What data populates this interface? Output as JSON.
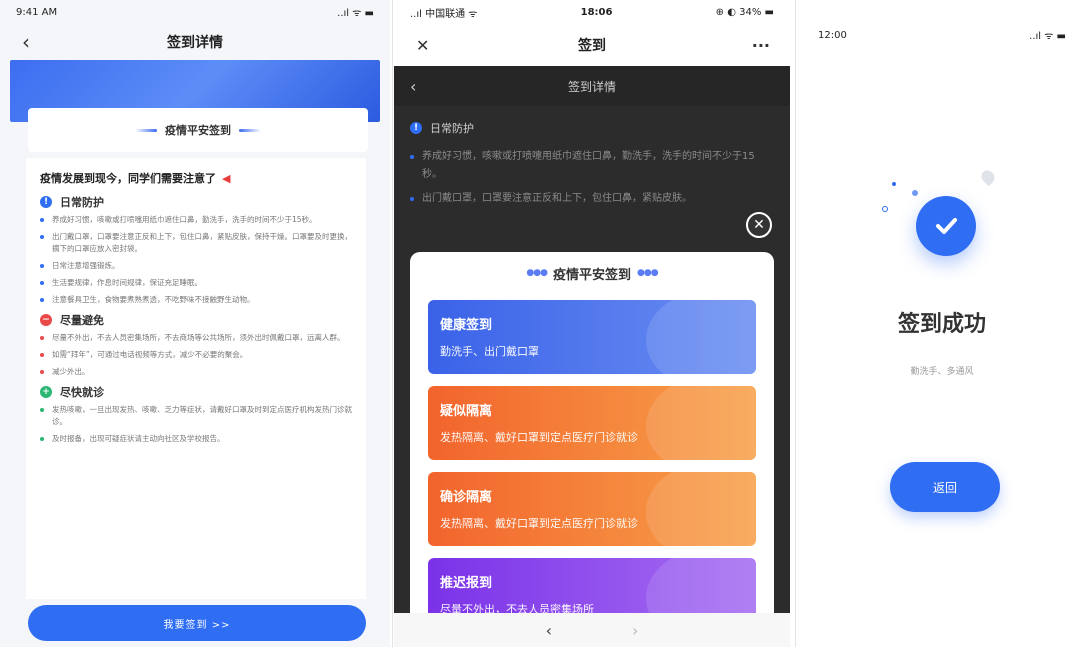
{
  "screen1": {
    "status": {
      "time": "9:41 AM",
      "signal": "..ıl ᯤ ▬"
    },
    "nav": {
      "back": "‹",
      "title": "签到详情"
    },
    "card_title": "疫情平安签到",
    "notice": "疫情发展到现今，同学们需要注意了",
    "sections": [
      {
        "icon": "info-icon",
        "icon_text": "!",
        "title": "日常防护",
        "color": "blue",
        "items": [
          "养成好习惯，咳嗽或打喷嚏用纸巾遮住口鼻，勤洗手，洗手的时间不少于15秒。",
          "出门戴口罩，口罩要注意正反和上下，包住口鼻，紧贴皮肤，保持干燥。口罩要及时更换，摘下的口罩应放入密封袋。",
          "日常注意增强锻炼。",
          "生活要规律，作息时间规律，保证充足睡眠。",
          "注意餐具卫生，食物要煮熟煮透，不吃野味不接触野生动物。"
        ]
      },
      {
        "icon": "minus-icon",
        "icon_text": "−",
        "title": "尽量避免",
        "color": "red",
        "items": [
          "尽量不外出，不去人员密集场所，不去商场等公共场所，须外出时佩戴口罩，远离人群。",
          "如需“拜年”，可通过电话视频等方式，减少不必要的聚会。",
          "减少外出。"
        ]
      },
      {
        "icon": "plus-icon",
        "icon_text": "+",
        "title": "尽快就诊",
        "color": "green",
        "items": [
          "发热咳嗽，一旦出现发热、咳嗽、乏力等症状，请戴好口罩及时到定点医疗机构发热门诊就诊。",
          "及时报备，出现可疑症状请主动向社区及学校报告。"
        ]
      }
    ],
    "button": "我要签到 >>"
  },
  "screen2": {
    "status": {
      "carrier": "..ıl 中国联通 ᯤ",
      "time": "18:06",
      "battery": "⊕ ◐ 34% ▬"
    },
    "nav": {
      "close": "✕",
      "title": "签到",
      "more": "···"
    },
    "bg_page": {
      "back": "‹",
      "title": "签到详情",
      "section": "日常防护",
      "items": [
        "养成好习惯，咳嗽或打喷嚏用纸巾遮住口鼻，勤洗手，洗手的时间不少于15秒。",
        "出门戴口罩，口罩要注意正反和上下，包住口鼻，紧贴皮肤。"
      ]
    },
    "close_btn": "✕",
    "modal_title": "疫情平安签到",
    "options": [
      {
        "title": "健康签到",
        "desc": "勤洗手、出门戴口罩"
      },
      {
        "title": "疑似隔离",
        "desc": "发热隔离、戴好口罩到定点医疗门诊就诊"
      },
      {
        "title": "确诊隔离",
        "desc": "发热隔离、戴好口罩到定点医疗门诊就诊"
      },
      {
        "title": "推迟报到",
        "desc": "尽量不外出，不去人员密集场所"
      }
    ],
    "bottom_nav": {
      "back": "‹",
      "forward": "›"
    }
  },
  "screen3": {
    "status": {
      "time": "12:00",
      "signal": "..ıl ᯤ ▬"
    },
    "title": "签到成功",
    "subtitle": "勤洗手、多通风",
    "button": "返回"
  }
}
